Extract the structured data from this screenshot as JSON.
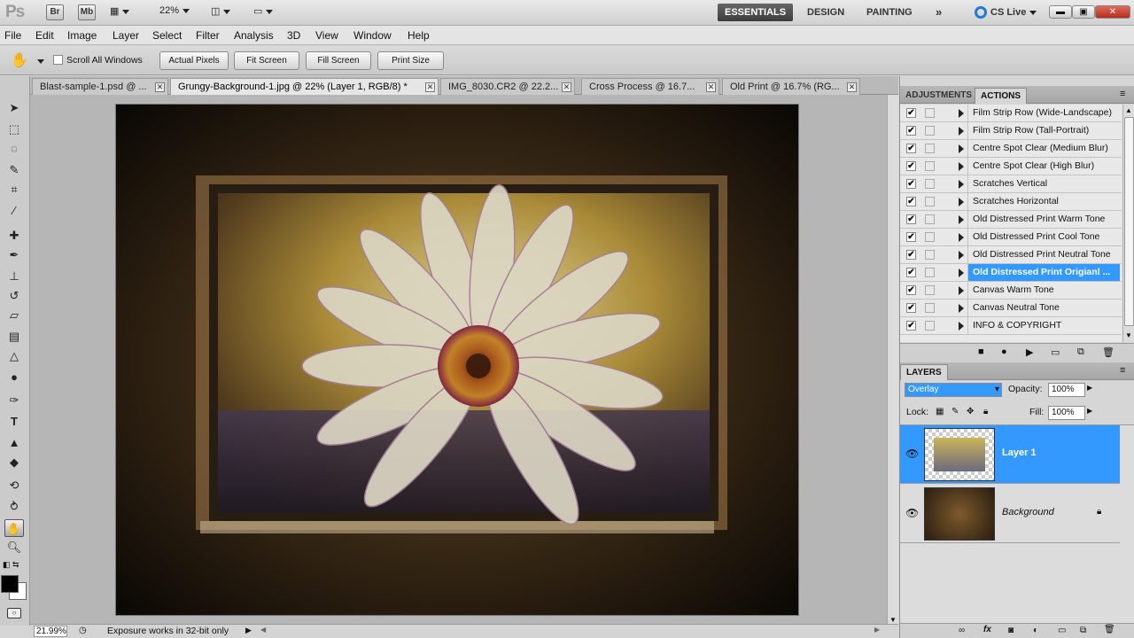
{
  "app": {
    "logo": "Ps",
    "bridge_label": "Br",
    "minibridge_label": "Mb",
    "zoom": "22%"
  },
  "workspaces": {
    "essentials": "ESSENTIALS",
    "design": "DESIGN",
    "painting": "PAINTING",
    "more": "»",
    "cs_live": "CS Live"
  },
  "window_controls": {
    "minimize": "▬",
    "restore": "▣",
    "close": "✕"
  },
  "menu": [
    "File",
    "Edit",
    "Image",
    "Layer",
    "Select",
    "Filter",
    "Analysis",
    "3D",
    "View",
    "Window",
    "Help"
  ],
  "options": {
    "scroll_all": "Scroll All Windows",
    "actual_pixels": "Actual Pixels",
    "fit_screen": "Fit Screen",
    "fill_screen": "Fill Screen",
    "print_size": "Print Size"
  },
  "tabs": [
    {
      "label": "Blast-sample-1.psd @ ..."
    },
    {
      "label": "Grungy-Background-1.jpg @ 22% (Layer 1, RGB/8) *"
    },
    {
      "label": "IMG_8030.CR2 @ 22.2..."
    },
    {
      "label": "Cross Process @ 16.7..."
    },
    {
      "label": "Old Print @ 16.7% (RG..."
    }
  ],
  "status": {
    "zoom": "21.99%",
    "message": "Exposure works in 32-bit only"
  },
  "panels": {
    "adjustments_tab": "ADJUSTMENTS",
    "actions_tab": "ACTIONS",
    "layers_tab": "LAYERS",
    "actions": [
      {
        "label": "Film Strip Row (Wide-Landscape)",
        "checked": true
      },
      {
        "label": "Film Strip Row (Tall-Portrait)",
        "checked": true
      },
      {
        "label": "Centre Spot Clear (Medium Blur)",
        "checked": true
      },
      {
        "label": "Centre Spot Clear (High Blur)",
        "checked": true
      },
      {
        "label": "Scratches Vertical",
        "checked": true
      },
      {
        "label": "Scratches Horizontal",
        "checked": true
      },
      {
        "label": "Old Distressed Print Warm Tone",
        "checked": true
      },
      {
        "label": "Old Distressed Print Cool Tone",
        "checked": true
      },
      {
        "label": "Old Distressed Print Neutral Tone",
        "checked": true
      },
      {
        "label": "Old Distressed Print Origianl ...",
        "checked": true,
        "selected": true
      },
      {
        "label": "Canvas Warm Tone",
        "checked": true
      },
      {
        "label": "Canvas Neutral Tone",
        "checked": true
      },
      {
        "label": "INFO & COPYRIGHT",
        "checked": true
      }
    ],
    "blend_mode": "Overlay",
    "opacity_label": "Opacity:",
    "opacity": "100%",
    "lock_label": "Lock:",
    "fill_label": "Fill:",
    "fill": "100%",
    "layers": [
      {
        "name": "Layer 1",
        "selected": true
      },
      {
        "name": "Background",
        "selected": false
      }
    ]
  },
  "colors": {
    "accent": "#3399ff",
    "selected_row": "#3399ff"
  }
}
